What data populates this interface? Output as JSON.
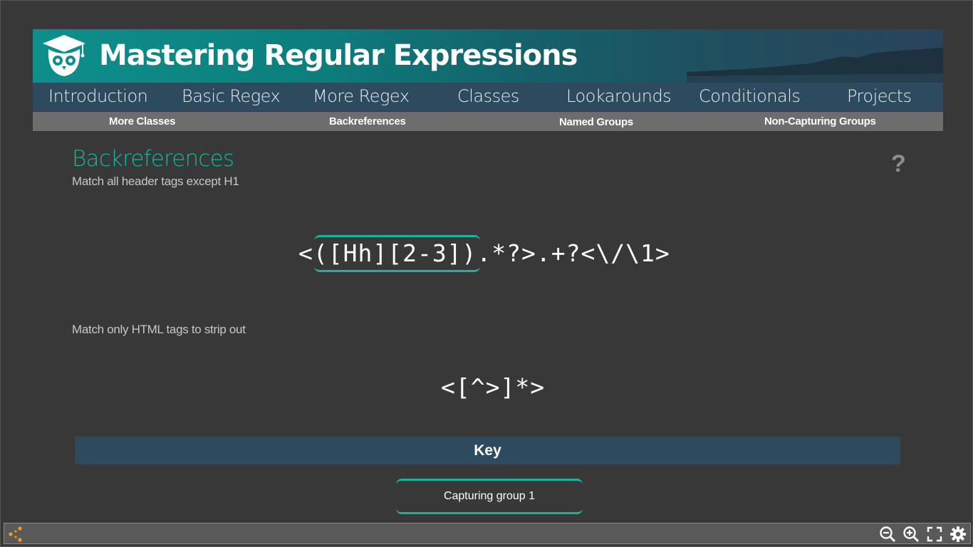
{
  "banner": {
    "title": "Mastering Regular Expressions",
    "logo_icon": "owl-graduation-cap-icon"
  },
  "nav": {
    "items": [
      "Introduction",
      "Basic Regex",
      "More Regex",
      "Classes",
      "Lookarounds",
      "Conditionals",
      "Projects"
    ]
  },
  "subnav": {
    "items": [
      "More Classes",
      "Backreferences",
      "Named Groups",
      "Non-Capturing Groups"
    ]
  },
  "content": {
    "title": "Backreferences",
    "help": "?",
    "example1": {
      "description": "Match all header tags except H1",
      "regex_group": "([Hh][2-3])",
      "regex_prefix": "<",
      "regex_rest": ".*?>.+?<\\/\\1>"
    },
    "example2": {
      "description": "Match only HTML tags to strip out",
      "regex": "<[^>]*>"
    }
  },
  "key": {
    "heading": "Key",
    "items": [
      "Capturing group 1"
    ]
  },
  "toolbar": {
    "icons": [
      "share-icon",
      "zoom-out-icon",
      "zoom-in-icon",
      "fullscreen-icon",
      "settings-icon"
    ]
  },
  "colors": {
    "accent": "#19b49a",
    "nav_bg": "#2e4a5f",
    "subnav_bg": "#6d6d6d",
    "page_bg": "#383838",
    "share_icon": "#f39a1d"
  }
}
